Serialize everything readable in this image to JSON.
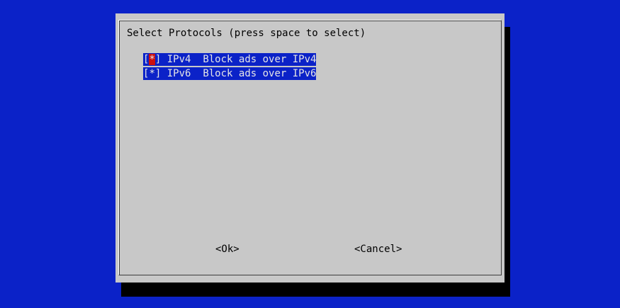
{
  "dialog": {
    "title": "Select Protocols (press space to select)",
    "items": [
      {
        "open_bracket": "[",
        "mark": "*",
        "close_bracket": "] ",
        "tag": "IPv4",
        "gap": "  ",
        "description": "Block ads over IPv4",
        "checked": true,
        "has_cursor": true
      },
      {
        "open_bracket": "[",
        "mark": "*",
        "close_bracket": "] ",
        "tag": "IPv6",
        "gap": "  ",
        "description": "Block ads over IPv6",
        "checked": true,
        "has_cursor": false
      }
    ],
    "buttons": {
      "ok_label": "<Ok>",
      "cancel_label": "<Cancel>"
    }
  },
  "colors": {
    "background": "#0b22c8",
    "dialog": "#c8c8c8",
    "selection": "#0b22c8",
    "cursor": "#cc1010",
    "shadow": "#000000"
  }
}
